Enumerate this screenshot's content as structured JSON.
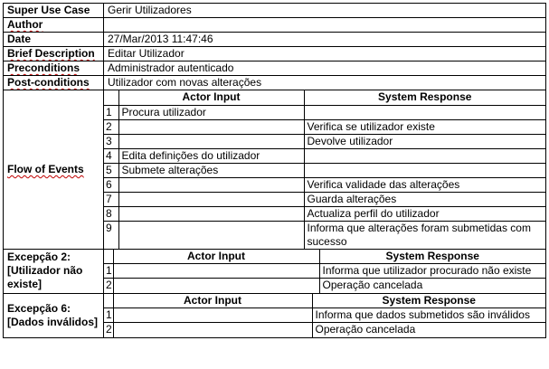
{
  "header": {
    "super_use_case_label": "Super Use Case",
    "super_use_case_value": "Gerir Utilizadores",
    "author_label": "Author",
    "author_value": "",
    "date_label": "Date",
    "date_value": "27/Mar/2013 11:47:46",
    "brief_label": "Brief Description",
    "brief_value": "Editar Utilizador",
    "pre_label": "Preconditions",
    "pre_value": "Administrador autenticado",
    "post_label": "Post-conditions",
    "post_value": "Utilizador com novas alterações"
  },
  "flow": {
    "label": "Flow of Events",
    "col_actor": "Actor Input",
    "col_system": "System Response",
    "rows": [
      {
        "n": "1",
        "actor": "Procura utilizador",
        "system": ""
      },
      {
        "n": "2",
        "actor": "",
        "system": "Verifica se utilizador existe"
      },
      {
        "n": "3",
        "actor": "",
        "system": "Devolve utilizador"
      },
      {
        "n": "4",
        "actor": "Edita definições do utilizador",
        "system": ""
      },
      {
        "n": "5",
        "actor": "Submete alterações",
        "system": ""
      },
      {
        "n": "6",
        "actor": "",
        "system": "Verifica validade das alterações"
      },
      {
        "n": "7",
        "actor": "",
        "system": "Guarda alterações"
      },
      {
        "n": "8",
        "actor": "",
        "system": "Actualiza perfil do utilizador"
      },
      {
        "n": "9",
        "actor": "",
        "system": "Informa que alterações foram submetidas com sucesso"
      }
    ]
  },
  "exc2": {
    "label": "Excepção 2: [Utilizador não existe]",
    "col_actor": "Actor Input",
    "col_system": "System Response",
    "rows": [
      {
        "n": "1",
        "actor": "",
        "system": "Informa que utilizador procurado não existe"
      },
      {
        "n": "2",
        "actor": "",
        "system": "Operação cancelada"
      }
    ]
  },
  "exc6": {
    "label": "Excepção 6: [Dados inválidos]",
    "col_actor": "Actor Input",
    "col_system": "System Response",
    "rows": [
      {
        "n": "1",
        "actor": "",
        "system": "Informa que dados submetidos são inválidos"
      },
      {
        "n": "2",
        "actor": "",
        "system": "Operação cancelada"
      }
    ]
  }
}
